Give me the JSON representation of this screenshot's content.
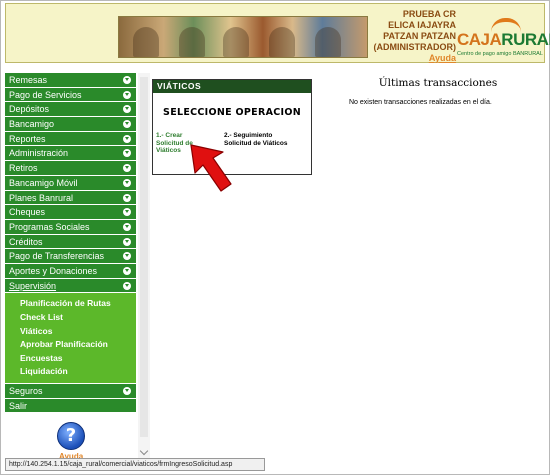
{
  "header": {
    "user_lines": [
      "PRUEBA CR",
      "ELICA IAJAYRA",
      "PATZAN PATZAN",
      "(ADMINISTRADOR)"
    ],
    "help_link": "Ayuda",
    "logo_caja": "CAJA",
    "logo_rural": "RURAL",
    "logo_tagline": "Centro de pago amigo BANRURAL"
  },
  "sidebar": {
    "items": [
      {
        "label": "Remesas"
      },
      {
        "label": "Pago de Servicios"
      },
      {
        "label": "Depósitos"
      },
      {
        "label": "Bancamigo"
      },
      {
        "label": "Reportes"
      },
      {
        "label": "Administración"
      },
      {
        "label": "Retiros"
      },
      {
        "label": "Bancamigo Móvil"
      },
      {
        "label": "Planes Banrural"
      },
      {
        "label": "Cheques"
      },
      {
        "label": "Programas Sociales"
      },
      {
        "label": "Créditos"
      },
      {
        "label": "Pago de Transferencias"
      },
      {
        "label": "Aportes y Donaciones"
      },
      {
        "label": "Supervisión"
      }
    ],
    "submenu": [
      {
        "label": "Planificación de Rutas"
      },
      {
        "label": "Check List"
      },
      {
        "label": "Viáticos"
      },
      {
        "label": "Aprobar Planificación"
      },
      {
        "label": "Encuestas"
      },
      {
        "label": "Liquidación"
      }
    ],
    "bottom_items": [
      {
        "label": "Seguros"
      },
      {
        "label": "Salir"
      }
    ],
    "help_label": "Ayuda",
    "help_icon": "question-mark-icon"
  },
  "panel": {
    "title": "VIÁTICOS",
    "heading": "SELECCIONE OPERACION",
    "option1": "1.- Crear Solicitud de Viáticos",
    "option2": "2.- Seguimiento Solicitud de Viáticos"
  },
  "transactions": {
    "title": "Últimas transacciones",
    "empty_message": "No existen transacciones realizadas en el día."
  },
  "status_bar": {
    "url": "http://140.254.1.15/caja_rural/comercial/viaticos/frmIngresoSolicitud.asp"
  },
  "colors": {
    "nav_green": "#2a8a2a",
    "submenu_green": "#5cb82a",
    "panel_title": "#1f4f1f",
    "accent_orange": "#e0862a",
    "arrow_red": "#e01010"
  }
}
